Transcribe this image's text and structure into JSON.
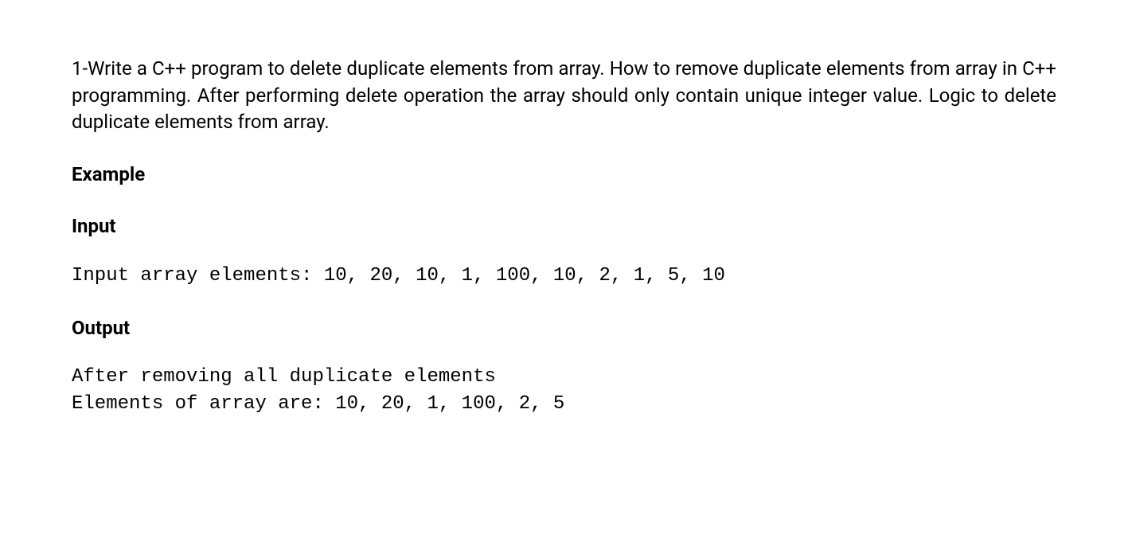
{
  "question": "1-Write a C++ program to delete duplicate elements from array. How to remove duplicate elements from array in C++ programming. After performing delete operation the array should only contain unique integer value. Logic to delete duplicate elements from array.",
  "example_heading": "Example",
  "input_heading": "Input",
  "input_text": "Input array elements: 10, 20, 10, 1, 100, 10, 2, 1, 5, 10",
  "output_heading": "Output",
  "output_lines": {
    "line1": "After removing all duplicate elements",
    "line2": "Elements of array are: 10, 20, 1, 100, 2, 5"
  }
}
